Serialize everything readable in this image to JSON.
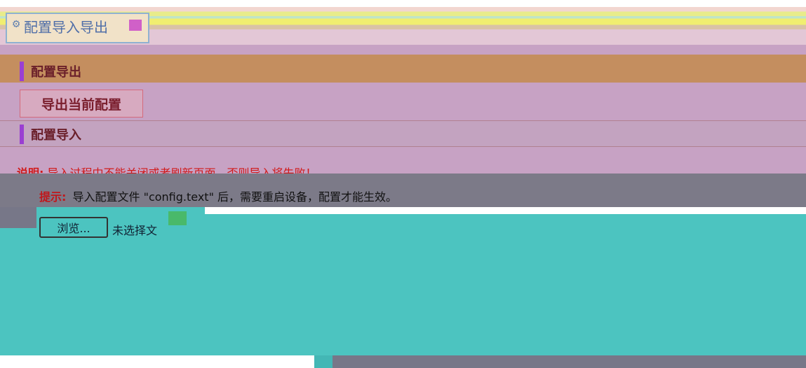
{
  "header": {
    "title": "配置导入导出",
    "icon": "settings-icon"
  },
  "export_section": {
    "title": "配置导出",
    "button_label": "导出当前配置"
  },
  "import_section": {
    "title": "配置导入",
    "note_label": "说明:",
    "note_text": "导入过程中不能关闭或者刷新页面，否则导入将失败！",
    "tip_label": "提示:",
    "tip_text": "导入配置文件 \"config.text\" 后，需要重启设备，配置才能生效。",
    "browse_label": "浏览...",
    "file_status": "未选择文"
  },
  "colors": {
    "accent": "#9a3fd2",
    "warning": "#d11a1a",
    "panel": "#c7a2c4",
    "overlay": "#4cc4c0"
  }
}
